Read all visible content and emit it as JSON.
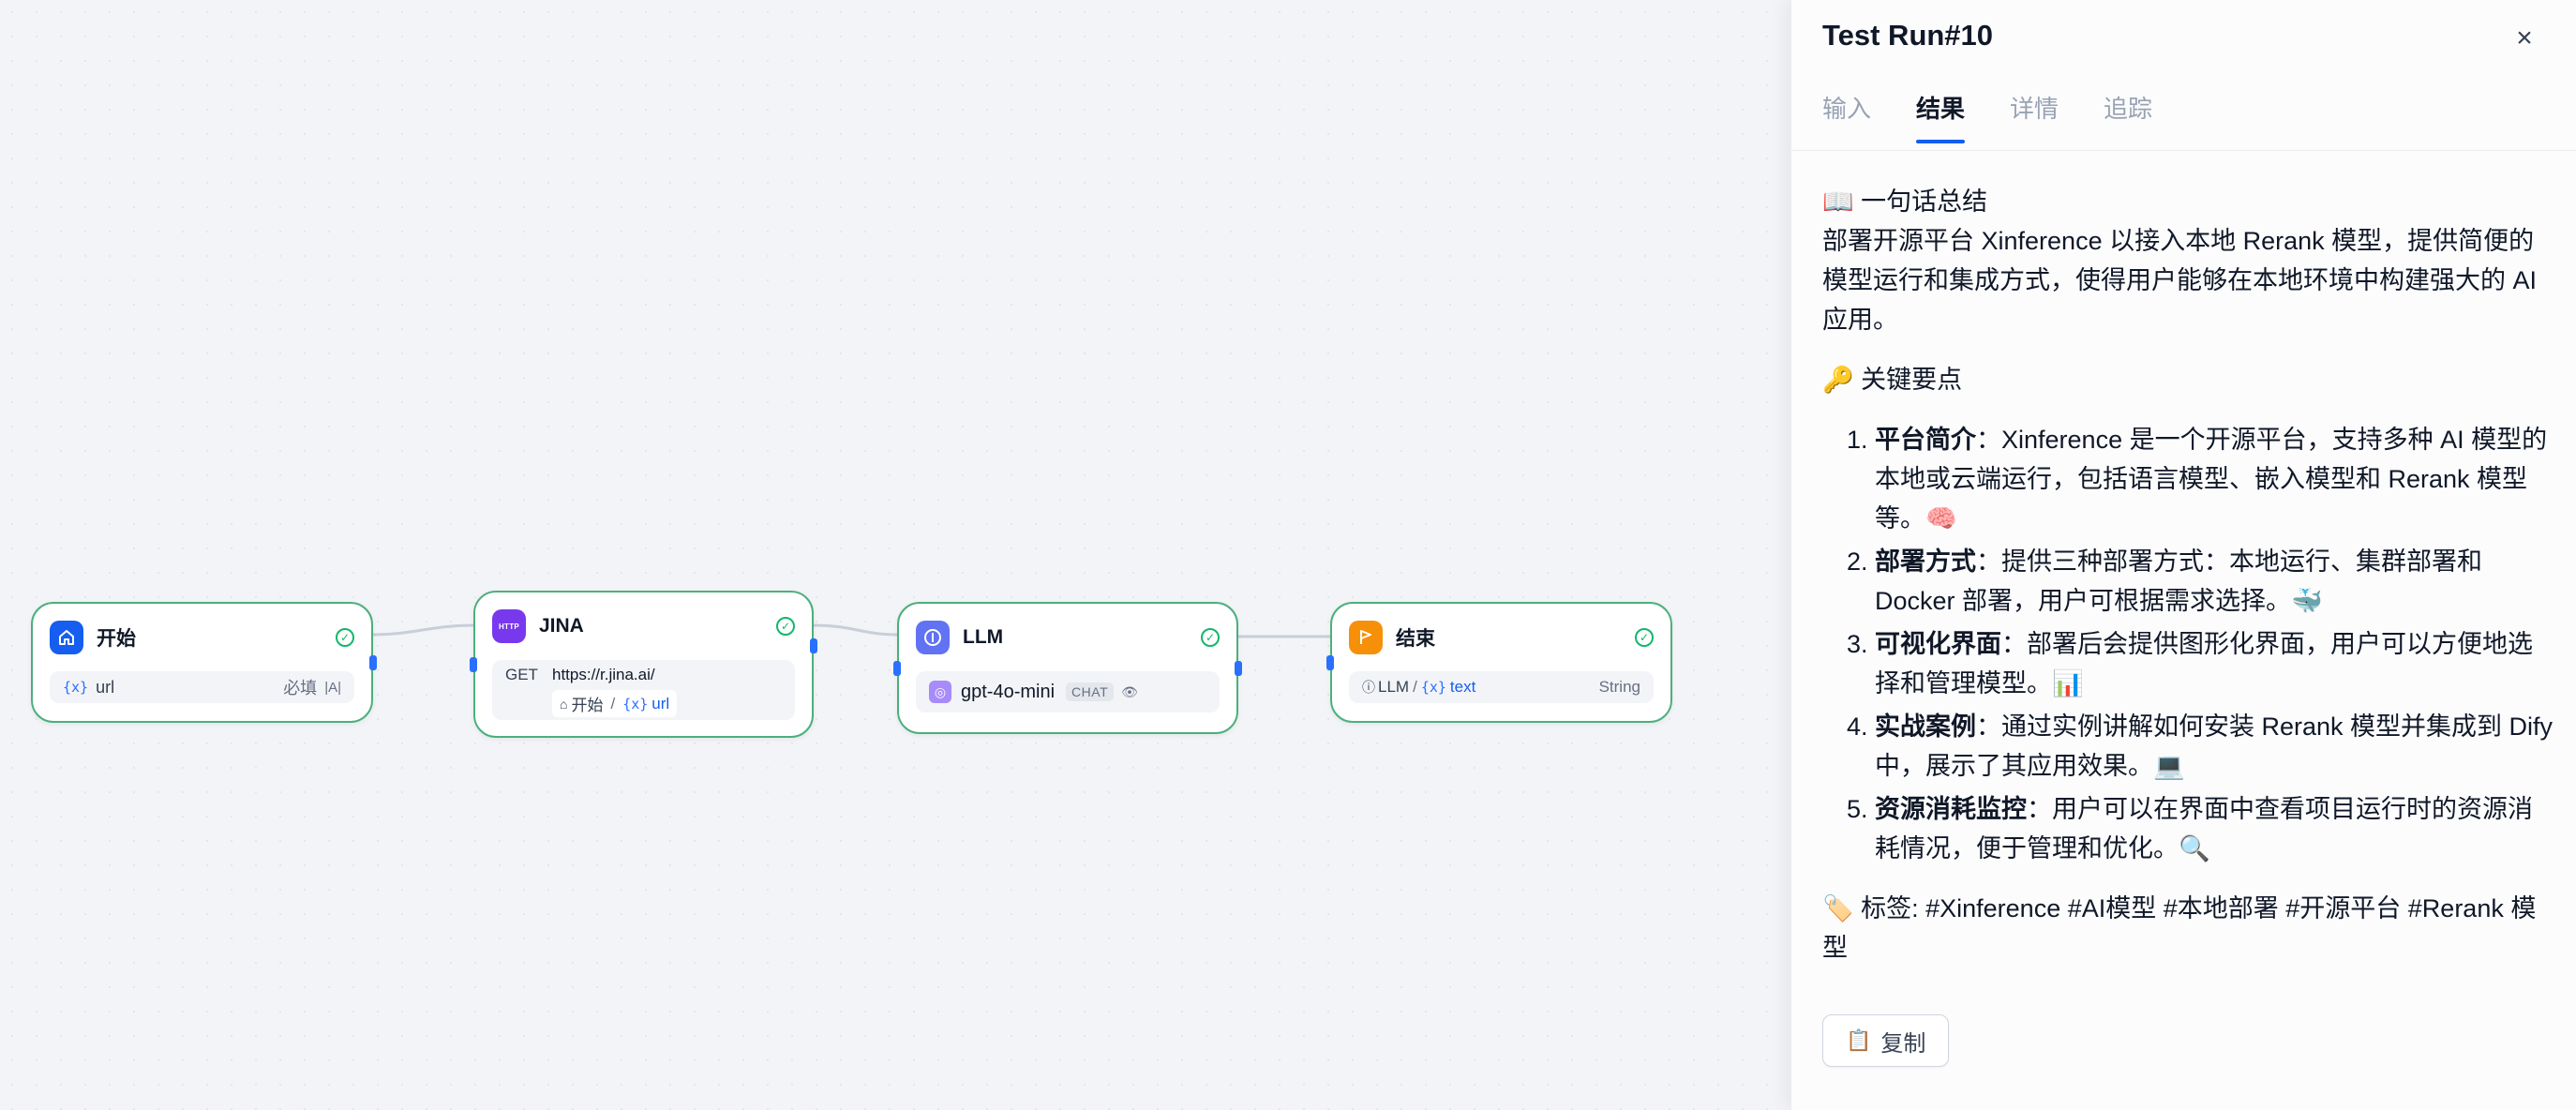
{
  "canvas": {
    "nodes": {
      "start": {
        "title": "开始",
        "icon": "home-icon",
        "color": "#155eef",
        "var_glyph": "{x}",
        "var_name": "url",
        "required": "必填",
        "type_badge": "|A|"
      },
      "http": {
        "title": "JINA",
        "icon": "http-icon",
        "icon_text": "HTTP",
        "color": "#7839ee",
        "method": "GET",
        "url": "https://r.jina.ai/",
        "param_node": "开始",
        "param_var": "url",
        "var_glyph": "{x}"
      },
      "llm": {
        "title": "LLM",
        "icon": "llm-icon",
        "color": "#6172f3",
        "model": "gpt-4o-mini",
        "mode": "CHAT"
      },
      "end": {
        "title": "结束",
        "icon": "end-flag-icon",
        "color": "#f79009",
        "source_node": "LLM",
        "var_glyph": "{x}",
        "var_name": "text",
        "type": "String"
      }
    }
  },
  "panel": {
    "title": "Test Run#10",
    "tabs": [
      "输入",
      "结果",
      "详情",
      "追踪"
    ],
    "active_tab": "结果",
    "result": {
      "summary_heading": "📖 一句话总结",
      "summary": "部署开源平台 Xinference 以接入本地 Rerank 模型，提供简便的模型运行和集成方式，使得用户能够在本地环境中构建强大的 AI 应用。",
      "points_heading": "🔑 关键要点",
      "points": [
        {
          "bold": "平台简介",
          "text": "：Xinference 是一个开源平台，支持多种 AI 模型的本地或云端运行，包括语言模型、嵌入模型和 Rerank 模型等。🧠"
        },
        {
          "bold": "部署方式",
          "text": "：提供三种部署方式：本地运行、集群部署和 Docker 部署，用户可根据需求选择。🐳"
        },
        {
          "bold": "可视化界面",
          "text": "：部署后会提供图形化界面，用户可以方便地选择和管理模型。📊"
        },
        {
          "bold": "实战案例",
          "text": "：通过实例讲解如何安装 Rerank 模型并集成到 Dify 中，展示了其应用效果。💻"
        },
        {
          "bold": "资源消耗监控",
          "text": "：用户可以在界面中查看项目运行时的资源消耗情况，便于管理和优化。🔍"
        }
      ],
      "tags": "🏷️ 标签: #Xinference #AI模型 #本地部署 #开源平台 #Rerank 模型"
    },
    "copy_label": "复制"
  }
}
